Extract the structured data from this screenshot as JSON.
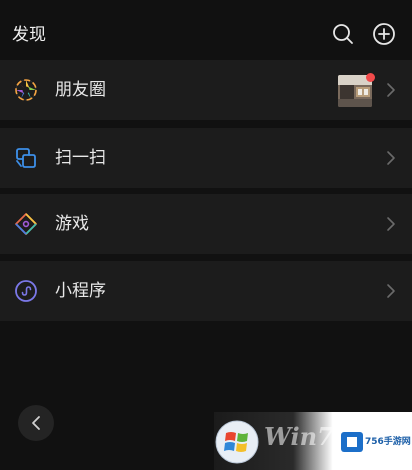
{
  "header": {
    "title": "发现",
    "icons": [
      "search-icon",
      "add-circle-icon"
    ]
  },
  "rows": [
    {
      "label": "朋友圈",
      "icon": "moments-aperture-icon",
      "has_thumbnail": true,
      "has_unread_dot": true
    },
    {
      "label": "扫一扫",
      "icon": "scan-icon"
    },
    {
      "label": "游戏",
      "icon": "games-icon"
    },
    {
      "label": "小程序",
      "icon": "mini-program-icon"
    }
  ],
  "watermark": {
    "win_text": "Win7",
    "site_text": "756手游网"
  },
  "colors": {
    "background": "#111111",
    "row_background": "#1c1c1c",
    "unread_dot": "#f24a4a",
    "scan_blue": "#3d8fe8",
    "mini_program_purple": "#7b78e8"
  }
}
